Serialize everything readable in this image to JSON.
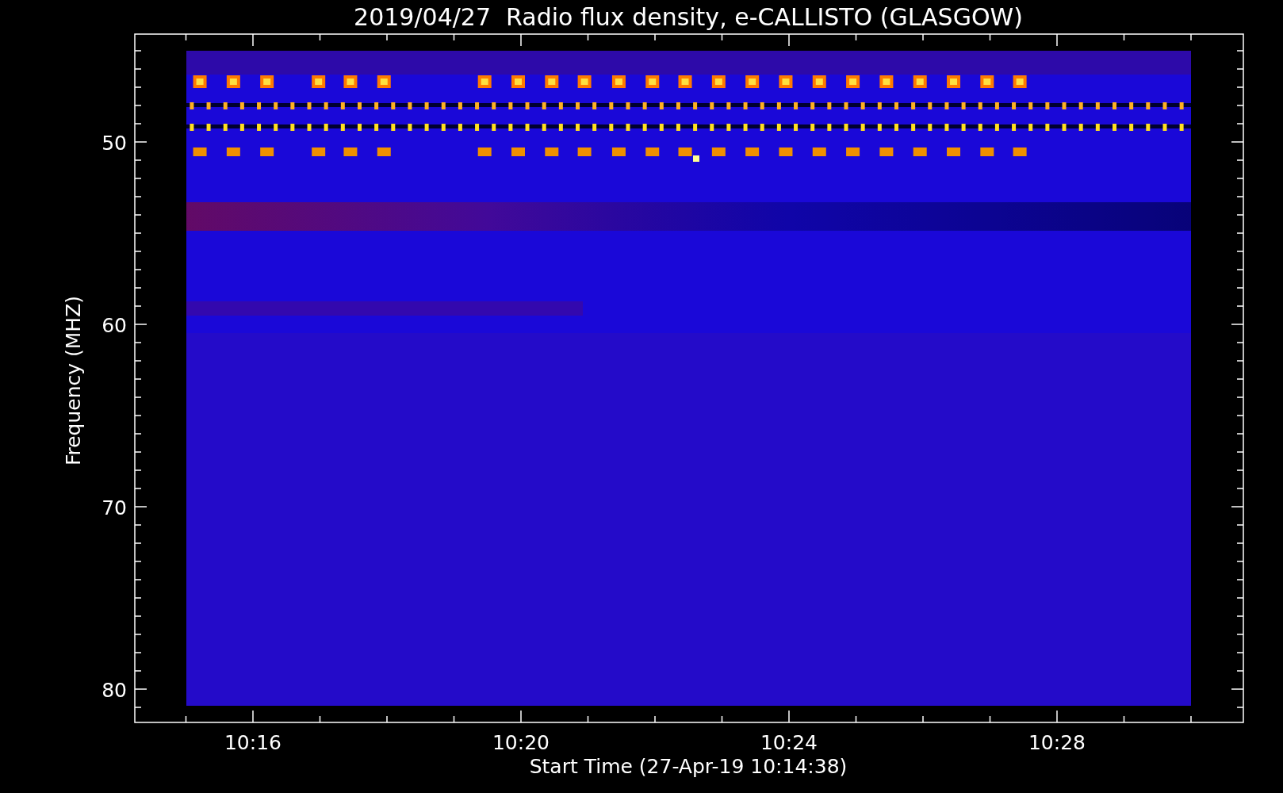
{
  "title": "2019/04/27  Radio flux density, e-CALLISTO (GLASGOW)",
  "ylabel": "Frequency (MHZ)",
  "xlabel": "Start Time (27-Apr-19 10:14:38)",
  "yticks": [
    "50",
    "60",
    "70",
    "80"
  ],
  "xticks": [
    "10:16",
    "10:20",
    "10:24",
    "10:28"
  ]
}
